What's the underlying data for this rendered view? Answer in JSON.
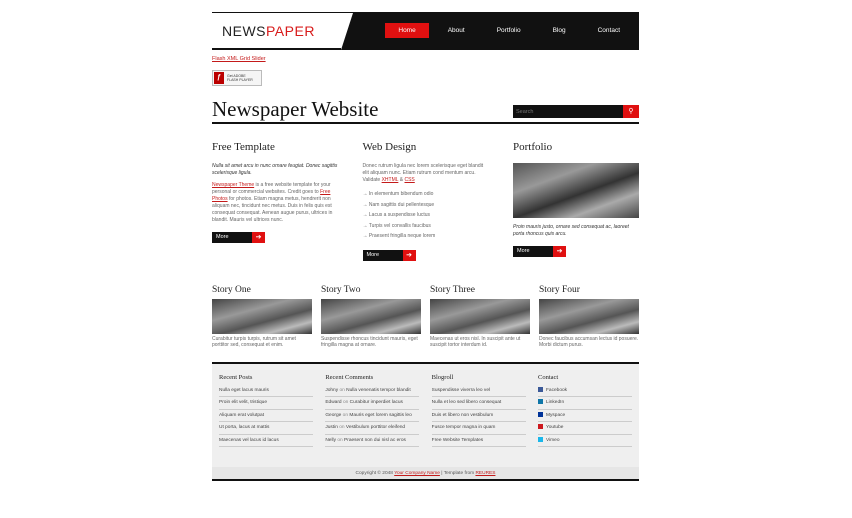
{
  "header": {
    "logo_part1": "NEWS",
    "logo_part2": "PAPER",
    "nav": [
      {
        "label": "Home"
      },
      {
        "label": "About"
      },
      {
        "label": "Portfolio"
      },
      {
        "label": "Blog"
      },
      {
        "label": "Contact"
      }
    ]
  },
  "top_link": "Flash XML Grid Slider",
  "flash_badge": {
    "icon": "flash-player-icon",
    "text_line1": "Get ADOBE",
    "text_line2": "FLASH PLAYER"
  },
  "page_title": "Newspaper Website",
  "search": {
    "placeholder": "Search",
    "button_icon": "search-icon"
  },
  "columns": {
    "free_template": {
      "title": "Free Template",
      "intro": "Nulla sit amet arcu in nunc ornare feugiat. Donec sagittis scelerisque ligula.",
      "link1": "Newspaper Theme",
      "text1": " is a free website template for your personal or commercial websites. Credit goes to ",
      "link2": "Free Photos",
      "text2": " for photos. Etiam magna metus, hendrerit non aliquam nec, tincidunt nec metus. Duis in felis quis est consequat consequat. Aenean augue purus, ultrices in blandit. Mauris vel ultrices nunc.",
      "more": "More"
    },
    "web_design": {
      "title": "Web Design",
      "text": "Donec rutrum ligula nec lorem scelerisque eget blandit elit aliquam nunc. Etiam rutrum cond mentum arcu. Validate ",
      "xhtml": "XHTML",
      "amp": " & ",
      "css": "CSS",
      "list": [
        "In elementum bibendum odio",
        "Nam sagittis dui pellentesque",
        "Lacus a suspendisse luctus",
        "Turpis vel convallis faucibus",
        "Praesent fringilla neque lorem"
      ],
      "more": "More"
    },
    "portfolio": {
      "title": "Portfolio",
      "caption": "Proin mauris justo, ornare sed consequat ac, laoreet porta rhoncus quis arcu.",
      "more": "More"
    }
  },
  "stories": [
    {
      "title": "Story One",
      "text": "Curabitur turpis turpis, rutrum sit amet porttitor sed, consequat et enim."
    },
    {
      "title": "Story Two",
      "text": "Suspendisse rhoncus tincidunt mauris, eget fringilla magna at ornare."
    },
    {
      "title": "Story Three",
      "text": "Maecenas ut eros nisl. In suscipit ante ut suscipit tortor interdum id."
    },
    {
      "title": "Story Four",
      "text": "Donec faucibus accumsan lectus id posuere. Morbi dictum purus."
    }
  ],
  "footer": {
    "recent_posts": {
      "title": "Recent Posts",
      "items": [
        "Nulla eget lacus mauris",
        "Proin elit velit, tristique",
        "Aliquam erat volutpat",
        "Ut porta, lacus at mattis",
        "Maecenas vel lacus id lacus"
      ]
    },
    "recent_comments": {
      "title": "Recent Comments",
      "on": "on",
      "items": [
        {
          "who": "Johny",
          "what": "Nulla venenatis tempor blandit"
        },
        {
          "who": "Edward",
          "what": "Curabitur imperdiet lacus"
        },
        {
          "who": "George",
          "what": "Mauris eget lorem sagittis leo"
        },
        {
          "who": "Justin",
          "what": "Vestibulum porttitor eleifend"
        },
        {
          "who": "Nelly",
          "what": "Praesent non dui nisl ac eros"
        }
      ]
    },
    "blogroll": {
      "title": "Blogroll",
      "items": [
        "Suspendisse viverra leo vel",
        "Nulla et leo sed libero consequat",
        "Duis et libero non vestibulum",
        "Fusce tempor magna in quam",
        "Free Website Templates"
      ]
    },
    "contact": {
      "title": "Contact",
      "items": [
        {
          "label": "Facebook",
          "icon": "facebook-icon",
          "color": "#3b5998"
        },
        {
          "label": "LinkedIn",
          "icon": "linkedin-icon",
          "color": "#0e76a8"
        },
        {
          "label": "Myspace",
          "icon": "myspace-icon",
          "color": "#003399"
        },
        {
          "label": "Youtube",
          "icon": "youtube-icon",
          "color": "#cc181e"
        },
        {
          "label": "Vimeo",
          "icon": "vimeo-icon",
          "color": "#1ab7ea"
        }
      ]
    }
  },
  "copyright": {
    "prefix": "Copyright © 2048 ",
    "company": "Your Company Name",
    "middle": " | Template from ",
    "source": "REURES"
  },
  "colors": {
    "accent": "#e01010",
    "dark": "#111111",
    "link": "#c41a1a"
  }
}
